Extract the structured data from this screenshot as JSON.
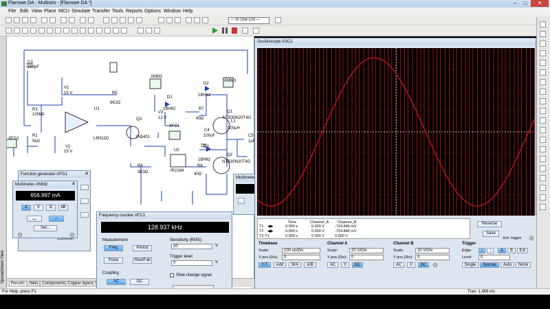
{
  "window": {
    "title": "Flanswe DA - Multisim - [Flanswe DA *]",
    "minimize_glyph": "–",
    "maximize_glyph": "□",
    "close_glyph": "✕"
  },
  "menu": [
    "File",
    "Edit",
    "View",
    "Place",
    "MCU",
    "Simulate",
    "Transfer",
    "Tools",
    "Reports",
    "Options",
    "Window",
    "Help"
  ],
  "toolbar": {
    "in_use_list": "--- In Use List ---"
  },
  "circuit": {
    "labels": {
      "c3": "C3",
      "c3_val": "220pF",
      "r3": "R3",
      "r3_val": "100kΩ",
      "r5": "R5",
      "r5_val": "6K2Ω",
      "v1": "V1",
      "v1_val": "15 V",
      "v2": "V2",
      "v2_val": "15 V",
      "u1": "U1",
      "u1_part": "LM311D",
      "r1": "R1",
      "r1_val": "5kΩ",
      "xfg1": "XFG1",
      "xmm1": "XMM1",
      "d1": "D1",
      "d1_part": "1BH62",
      "v3": "V3",
      "v3_val": "12 V",
      "q3": "Q3",
      "q3_part": "2N5401",
      "xfc1": "XFC1",
      "d2": "D2",
      "d2_part": "1BH62",
      "r7": "R7",
      "r7_val": "40Ω",
      "q1": "Q1",
      "q1_part": "NTB30N20T4G",
      "xmm3": "XMM3",
      "l1": "L1",
      "l1_val": "100μH",
      "c4": "C4",
      "c4_val": "100uF",
      "c5": "C5",
      "c5_val": "1μF",
      "r6": "R6",
      "r6_val": "3K3Ω",
      "u2": "U2",
      "u2_part": "IR2184",
      "d3": "D3",
      "d3_part": "1BH62",
      "r8": "R8",
      "r8_val": "40Ω",
      "q2": "Q2",
      "q2_part": "NTB30N20T4G"
    }
  },
  "left_vertical_label": "Spreadsheet View",
  "function_generator": {
    "title": "Function generator-XFG1",
    "common": "Common"
  },
  "multimeter": {
    "title": "Multimeter-XMM2",
    "reading": "656.997 mA",
    "buttons": [
      "A",
      "V",
      "Ω",
      "dB"
    ],
    "set_label": "Set..."
  },
  "multimeter2": {
    "title": "Multimeter-..."
  },
  "frequency_counter": {
    "title": "Frequency counter-XFC1",
    "reading": "128.937 kHz",
    "measurement_label": "Measurement",
    "buttons": [
      "Freq",
      "Period",
      "Pulse",
      "Rise/Fall"
    ],
    "sensitivity_label": "Sensitivity (RMS)",
    "sensitivity_value": "20",
    "sensitivity_unit": "V",
    "trigger_label": "Trigger level",
    "trigger_value": "0",
    "trigger_unit": "V",
    "coupling_label": "Coupling",
    "coupling_ac": "AC",
    "coupling_dc": "DC",
    "slow_change": "Slow change signal"
  },
  "oscilloscope": {
    "title": "Oscilloscope-XSC1",
    "readout": {
      "headers": [
        "Time",
        "Channel_A",
        "Channel_B"
      ],
      "rows": [
        {
          "label": "T1",
          "time": "0.000 s",
          "a": "0.000 V",
          "b": "-724.846 mV"
        },
        {
          "label": "T2",
          "time": "0.000 s",
          "a": "0.000 V",
          "b": "-724.846 mV"
        },
        {
          "label": "T2-T1",
          "time": "0.000 s",
          "a": "0.000 V",
          "b": "0.000 V"
        }
      ]
    },
    "reverse": "Reverse",
    "save": "Save",
    "ext_trigger": "Ext. trigger",
    "timebase": {
      "label": "Timebase",
      "scale_label": "Scale:",
      "scale": "100 us/Div",
      "xpos_label": "X pos.(Div):",
      "xpos": "0",
      "modes": [
        "Y/T",
        "Add",
        "B/A",
        "A/B"
      ]
    },
    "channel_a": {
      "label": "Channel A",
      "scale_label": "Scale:",
      "scale": "20 V/Div",
      "ypos_label": "Y pos.(Div):",
      "ypos": "0",
      "coupling": [
        "AC",
        "0",
        "DC"
      ]
    },
    "channel_b": {
      "label": "Channel B",
      "scale_label": "Scale:",
      "scale": "20 V/Div",
      "ypos_label": "Y pos.(Div):",
      "ypos": "0",
      "coupling": [
        "AC",
        "0",
        "DC"
      ]
    },
    "trigger": {
      "label": "Trigger",
      "edge_label": "Edge:",
      "level_label": "Level:",
      "level": "0",
      "sources": [
        "A",
        "B",
        "Ext"
      ],
      "modes": [
        "Single",
        "Normal",
        "Auto",
        "None"
      ]
    },
    "trace_color": "#b01818",
    "grid_color": "#5a5a5a"
  },
  "tabs": [
    "Results",
    "Nets",
    "Components",
    "Copper layers",
    "Si..."
  ],
  "status": {
    "help": "For Help, press F1",
    "tran": "Tran: 1.458 ms"
  }
}
